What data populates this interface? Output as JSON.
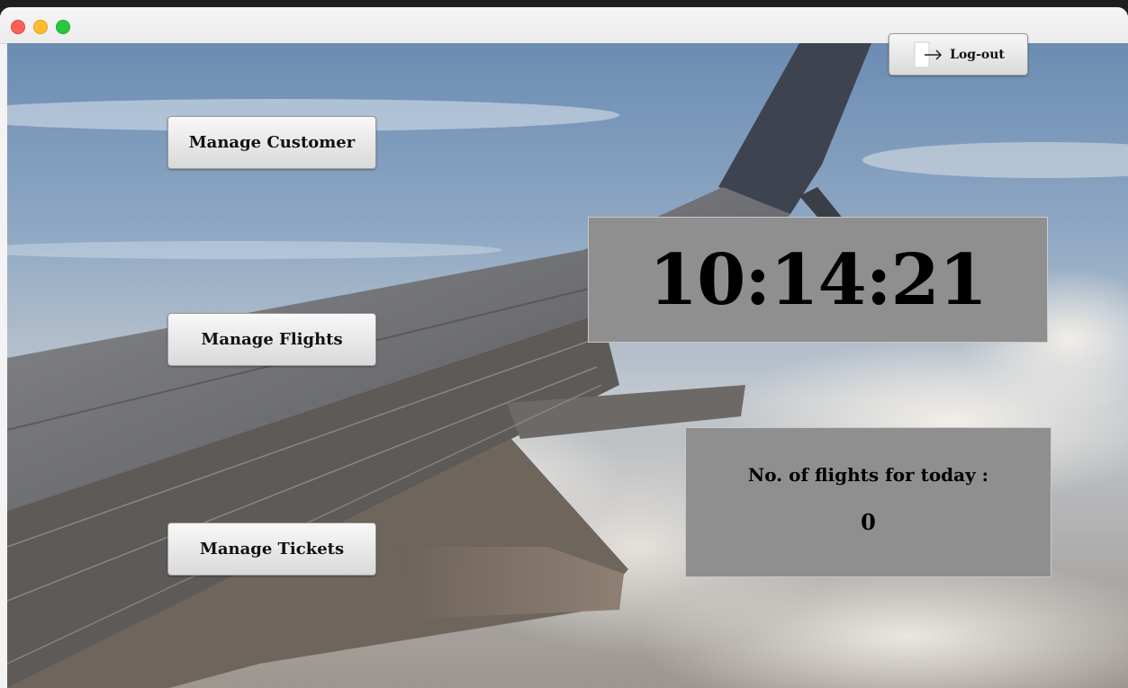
{
  "window": {
    "traffic_lights": [
      "close",
      "minimize",
      "maximize"
    ]
  },
  "menu": {
    "manage_customer_label": "Manage Customer",
    "manage_flights_label": "Manage Flights",
    "manage_tickets_label": "Manage Tickets"
  },
  "header": {
    "logout_label": "Log-out",
    "logout_icon": "logout-icon"
  },
  "clock": {
    "time": "10:14:21"
  },
  "flights_panel": {
    "label": "No. of flights for today :",
    "count": "0"
  },
  "colors": {
    "panel_bg": "#8f8f8f",
    "button_top": "#f8f8f8",
    "button_bottom": "#d9d9d9"
  }
}
